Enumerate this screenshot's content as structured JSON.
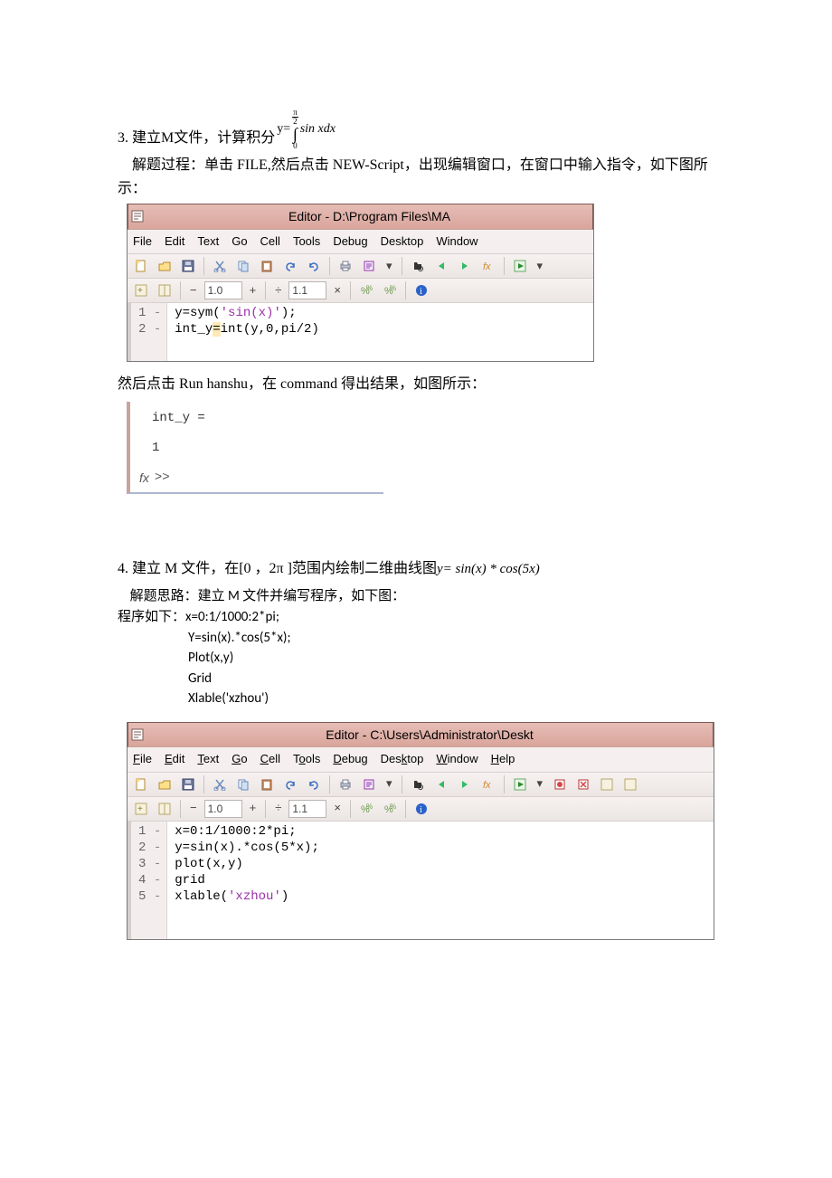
{
  "problem3": {
    "num": "3. ",
    "text_before_formula": "建立M文件，计算积分 ",
    "formula": {
      "yeq": "y=",
      "upper_num": "π",
      "upper_den": "2",
      "lower": "0",
      "body": "sin xdx"
    },
    "proc_line": "    解题过程：单击 FILE,然后点击 NEW-Script，出现编辑窗口，在窗口中输入指令，如下图所示：",
    "after_editor": "然后点击 Run hanshu，在 command 得出结果，如图所示：",
    "cmd_out": {
      "l1": "int_y =",
      "l2": "1",
      "fx": "fx",
      "prompt": ">>"
    }
  },
  "editor1": {
    "title": "Editor - D:\\Program Files\\MA",
    "menu": [
      "File",
      "Edit",
      "Text",
      "Go",
      "Cell",
      "Tools",
      "Debug",
      "Desktop",
      "Window"
    ],
    "cell_left": "1.0",
    "cell_right": "1.1",
    "gutter": [
      [
        "1",
        "-"
      ],
      [
        "2",
        "-"
      ]
    ],
    "code": {
      "l1a": "y=sym(",
      "l1b": "'sin(x)'",
      "l1c": ");",
      "l2a": "int_y",
      "l2warn": "=",
      "l2b": "int(y,0,pi/2)"
    }
  },
  "problem4": {
    "num": "4. ",
    "text": "建立 M 文件，在[0 ，2π ]范围内绘制二维曲线图 ",
    "formula": "y= sin(x) * cos(5x)",
    "proc_line": "    解题思路：建立 M 文件并编写程序，如下图：",
    "code_intro": "程序如下：",
    "code_lines": [
      "x=0:1/1000:2*pi;",
      "Y=sin(x).*cos(5*x);",
      "Plot(x,y)",
      "Grid",
      "Xlable('xzhou')"
    ]
  },
  "editor2": {
    "title": "Editor - C:\\Users\\Administrator\\Deskt",
    "menu": {
      "f": "File",
      "e": "Edit",
      "t": "Text",
      "g": "Go",
      "c": "Cell",
      "o": "Tools",
      "d": "Debug",
      "k": "Desktop",
      "w": "Window",
      "h": "Help"
    },
    "cell_left": "1.0",
    "cell_right": "1.1",
    "gutter": [
      [
        "1",
        "-"
      ],
      [
        "2",
        "-"
      ],
      [
        "3",
        "-"
      ],
      [
        "4",
        "-"
      ],
      [
        "5",
        "-"
      ]
    ],
    "code": {
      "l1": "x=0:1/1000:2*pi;",
      "l2": "y=sin(x).*cos(5*x);",
      "l3": "plot(x,y)",
      "l4": "grid",
      "l5a": "xlable(",
      "l5b": "'xzhou'",
      "l5c": ")"
    }
  }
}
